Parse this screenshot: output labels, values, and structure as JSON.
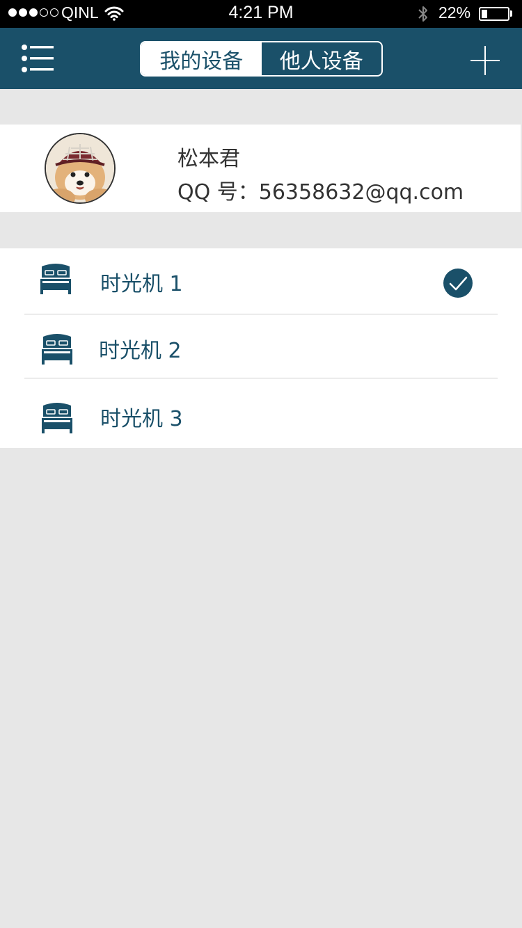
{
  "status_bar": {
    "carrier": "QINL",
    "time": "4:21 PM",
    "battery_percent": "22%",
    "battery_level": 0.22,
    "signal_bars_filled": 3,
    "signal_bars_total": 5
  },
  "nav": {
    "tabs": [
      {
        "label": "我的设备",
        "active": true
      },
      {
        "label": "他人设备",
        "active": false
      }
    ],
    "menu_icon": "list-menu-icon",
    "add_icon": "plus-icon"
  },
  "profile": {
    "name": "松本君",
    "qq": "QQ 号：56358632@qq.com"
  },
  "devices": [
    {
      "label": "时光机 1",
      "selected": true,
      "icon": "bed-icon"
    },
    {
      "label": "时光机 2",
      "selected": false,
      "icon": "bed-icon"
    },
    {
      "label": "时光机 3",
      "selected": false,
      "icon": "bed-icon"
    }
  ],
  "colors": {
    "primary": "#1a5069",
    "background": "#e7e7e7",
    "card": "#ffffff"
  }
}
